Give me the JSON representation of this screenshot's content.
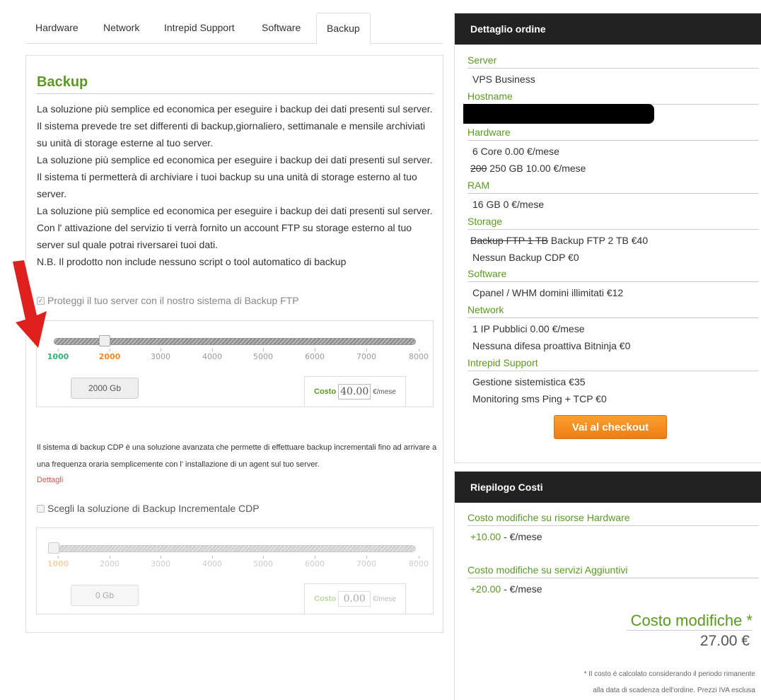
{
  "tabs": [
    "Hardware",
    "Network",
    "Intrepid Support",
    "Software",
    "Backup"
  ],
  "backup": {
    "title": "Backup",
    "description": [
      "La soluzione più semplice ed economica per eseguire i backup dei dati presenti sul server. Il sistema prevede tre set differenti di backup,giornaliero, settimanale e mensile archiviati su unità di storage esterne al tuo server.",
      "La soluzione più semplice ed economica per eseguire i backup dei dati presenti sul server. Il sistema ti permetterà di archiviare i tuoi backup su una unità di storage esterno al tuo server.",
      "La soluzione più semplice ed economica per eseguire i backup dei dati presenti sul server.",
      "Con l' attivazione del servizio ti verrà fornito un account FTP su storage esterno al tuo server sul quale potrai riversarei tuoi dati.",
      "N.B. Il prodotto non include nessuno script o tool automatico di backup"
    ],
    "ftp_checkbox_label": "Proteggi il tuo server con il nostro sistema di Backup FTP",
    "ftp_slider": {
      "ticks": [
        "1000",
        "2000",
        "3000",
        "4000",
        "5000",
        "6000",
        "7000",
        "8000"
      ],
      "value_display": "2000 Gb",
      "selected_level": 0.143,
      "cost_label": "Costo",
      "cost_value": "40.00",
      "cost_unit": "€/mese"
    },
    "cdp_text": "Il sistema di backup CDP è una soluzione avanzata che permette di effettuare backup incrementali fino ad arrivare a una frequenza oraria semplicemente con l' installazione di un agent sul tuo server.",
    "cdp_link": "Dettagli",
    "cdp_checkbox_label": "Scegli la soluzione di Backup Incrementale CDP",
    "cdp_slider": {
      "ticks": [
        "1000",
        "2000",
        "3000",
        "4000",
        "5000",
        "6000",
        "7000",
        "8000"
      ],
      "value_display": "0 Gb",
      "selected_level": 0.0,
      "cost_label": "Costo",
      "cost_value": "0.00",
      "cost_unit": "€/mese"
    }
  },
  "order": {
    "header": "Dettaglio ordine",
    "server_label": "Server",
    "server_value": "VPS Business",
    "hostname_label": "Hostname",
    "hardware_label": "Hardware",
    "hardware_row1": "6 Core 0.00 €/mese",
    "hardware_row2_old": "200",
    "hardware_row2": " 250 GB 10.00 €/mese",
    "ram_label": "RAM",
    "ram_row": "16 GB 0 €/mese",
    "storage_label": "Storage",
    "storage_row1_old": "Backup FTP 1 TB",
    "storage_row1": " Backup FTP 2 TB €40",
    "storage_row2": "Nessun Backup CDP €0",
    "software_label": "Software",
    "software_row": "Cpanel / WHM domini illimitati €12",
    "network_label": "Network",
    "network_row1": "1 IP Pubblici 0.00 €/mese",
    "network_row2": "Nessuna difesa proattiva Bitninja €0",
    "support_label": "Intrepid Support",
    "support_row1": "Gestione sistemistica €35",
    "support_row2": "Monitoring sms Ping + TCP €0",
    "checkout_button": "Vai al checkout"
  },
  "summary": {
    "header": "Riepilogo Costi",
    "hw_label": "Costo modifiche su risorse Hardware",
    "hw_amount": "+10.00",
    "hw_unit": " - €/mese",
    "extra_label": "Costo modifiche su servizi Aggiuntivi",
    "extra_amount": "+20.00",
    "extra_unit": " - €/mese",
    "total_label": "Costo modifiche *",
    "total_value": "27.00 €",
    "note_line1": "* Il costo é calcolato considerando il periodo rimanente",
    "note_line2": "alla data di scadenza dell'ordine. Prezzi IVA esclusa"
  },
  "colors": {
    "accent_green": "#5a9a1f",
    "checkout_orange": "#f39020",
    "header_dark": "#222222",
    "link_red": "#d9534f"
  }
}
